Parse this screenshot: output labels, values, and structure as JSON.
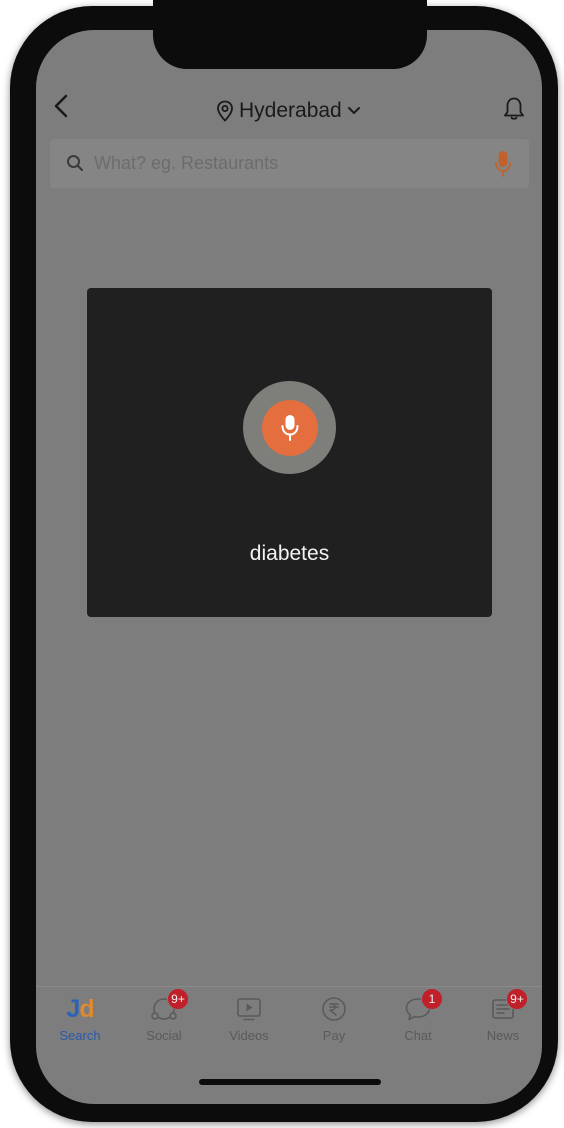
{
  "header": {
    "location": "Hyderabad"
  },
  "search": {
    "placeholder": "What? eg. Restaurants"
  },
  "voice": {
    "transcript": "diabetes"
  },
  "nav": {
    "items": [
      {
        "label": "Search",
        "icon": "jd-logo",
        "badge": ""
      },
      {
        "label": "Social",
        "icon": "social-icon",
        "badge": "9+"
      },
      {
        "label": "Videos",
        "icon": "video-play-icon",
        "badge": ""
      },
      {
        "label": "Pay",
        "icon": "rupee-icon",
        "badge": ""
      },
      {
        "label": "Chat",
        "icon": "chat-bubble-icon",
        "badge": "1"
      },
      {
        "label": "News",
        "icon": "news-icon",
        "badge": "9+"
      }
    ],
    "logo": {
      "j": "J",
      "d": "d"
    }
  },
  "colors": {
    "accent": "#e46e3e",
    "overlay": "#7d7d7d",
    "dialog": "#202020",
    "badge": "#c0202a",
    "active_nav": "#2a5aa8"
  }
}
